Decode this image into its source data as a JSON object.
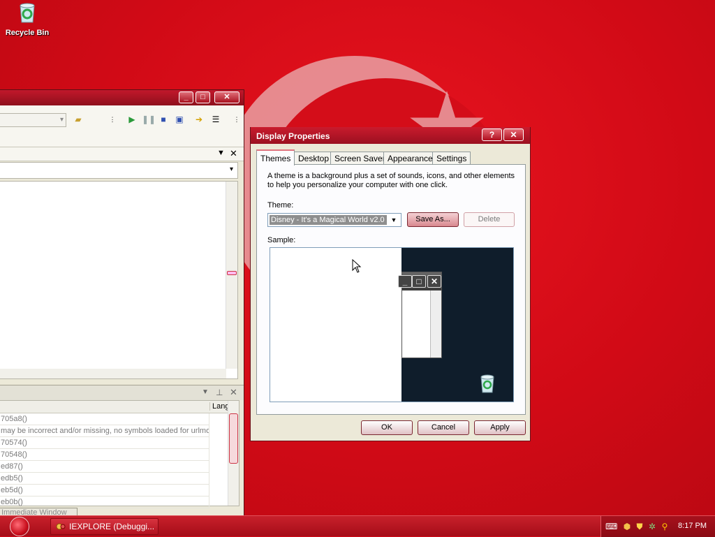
{
  "desktop": {
    "icons": [
      {
        "label": "Recycle Bin",
        "icon": "recycle-bin-icon"
      }
    ]
  },
  "debugger": {
    "title_buttons": [
      "minimize",
      "maximize",
      "close"
    ],
    "panel_header_buttons": [
      "dropdown",
      "pin",
      "close"
    ],
    "table": {
      "column_header": "Lang",
      "rows": [
        "705a8()",
        "may be incorrect and/or missing, no symbols loaded for urlmon",
        "70574()",
        "70548()",
        "ed87()",
        "edb5()",
        "eb5d()",
        "eb0b()"
      ]
    },
    "bottom_tab": "Immediate Window"
  },
  "display_properties": {
    "title": "Display Properties",
    "help_glyph": "?",
    "close_glyph": "✕",
    "tabs": [
      "Themes",
      "Desktop",
      "Screen Saver",
      "Appearance",
      "Settings"
    ],
    "active_tab": "Themes",
    "description": "A theme is a background plus a set of sounds, icons, and other elements to help you personalize your computer with one click.",
    "theme_label": "Theme:",
    "theme_value": "Disney - It's a Magical World v2.0",
    "save_as_label": "Save As...",
    "delete_label": "Delete",
    "sample_label": "Sample:",
    "ok_label": "OK",
    "cancel_label": "Cancel",
    "apply_label": "Apply"
  },
  "taskbar": {
    "tasks": [
      {
        "label": "IEXPLORE (Debuggi...",
        "icon": "debugger-icon"
      }
    ],
    "clock": "8:17 PM",
    "tray_icons": [
      "keyboard-icon",
      "network-icon",
      "shield-icon",
      "antivirus-icon",
      "search-icon"
    ]
  },
  "colors": {
    "accent": "#c91b2d",
    "wallpaper": "#d40a18"
  }
}
